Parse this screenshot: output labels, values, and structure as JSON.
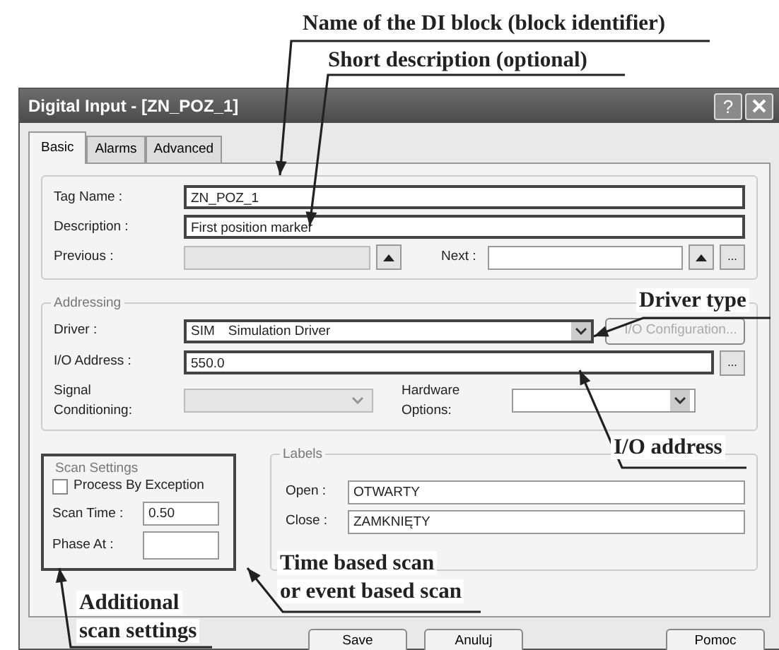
{
  "window": {
    "title": "Digital Input - [ZN_POZ_1]",
    "buttons": [
      {
        "kind": "help",
        "label": "?"
      },
      {
        "kind": "close"
      }
    ]
  },
  "tabs": [
    {
      "label": "Basic",
      "selected": true
    },
    {
      "label": "Alarms",
      "selected": false
    },
    {
      "label": "Advanced",
      "selected": false
    }
  ],
  "identity": {
    "tag_name": {
      "label": "Tag Name :",
      "value": "ZN_POZ_1"
    },
    "description": {
      "label": "Description :",
      "value": "First position marker"
    },
    "previous": {
      "label": "Previous :",
      "disabled": true
    },
    "next": {
      "label": "Next :",
      "disabled": false,
      "browse": "..."
    }
  },
  "addressing": {
    "title": "Addressing",
    "driver": {
      "label": "Driver :",
      "code": "SIM",
      "name": "Simulation Driver"
    },
    "io_configuration": {
      "label": "I/O Configuration...",
      "disabled": true
    },
    "io_address": {
      "label": "I/O Address :",
      "value": "550.0",
      "browse": "..."
    },
    "signal_conditioning": {
      "label": "Signal Conditioning:",
      "disabled": true
    },
    "hardware_options": {
      "label": "Hardware Options:",
      "disabled": false
    }
  },
  "scan_settings": {
    "title": "Scan Settings",
    "process_by_exception": {
      "label": "Process By Exception",
      "checked": false
    },
    "scan_time": {
      "label": "Scan Time :",
      "value": "0.50"
    },
    "phase_at": {
      "label": "Phase At :"
    }
  },
  "labels": {
    "title": "Labels",
    "open": {
      "label": "Open :",
      "value": "OTWARTY"
    },
    "close": {
      "label": "Close :",
      "value": "ZAMKNIĘTY"
    }
  },
  "buttons": [
    "Save",
    "Anuluj",
    "Pomoc"
  ],
  "annotations": [
    {
      "kind": "name",
      "text": "Name of the DI block (block identifier)"
    },
    {
      "kind": "description",
      "text": "Short description (optional)"
    },
    {
      "kind": "driver",
      "text": "Driver type"
    },
    {
      "kind": "address",
      "text": "I/O address"
    },
    {
      "kind": "scan",
      "lines": [
        "Time based scan",
        "or event based scan"
      ]
    },
    {
      "kind": "additional",
      "lines": [
        "Additional",
        "scan settings"
      ]
    }
  ]
}
